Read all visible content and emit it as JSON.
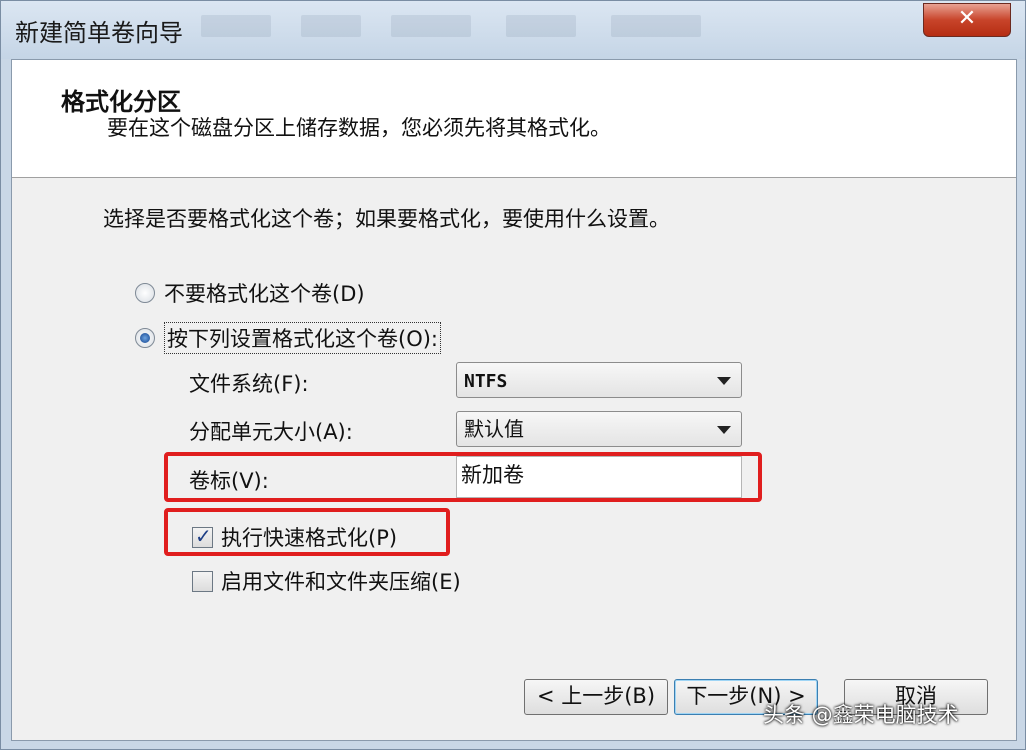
{
  "window": {
    "title": "新建简单卷向导",
    "close_glyph": "✕"
  },
  "header": {
    "title": "格式化分区",
    "description": "要在这个磁盘分区上储存数据，您必须先将其格式化。"
  },
  "prompt": "选择是否要格式化这个卷；如果要格式化，要使用什么设置。",
  "options": {
    "no_format": {
      "label": "不要格式化这个卷(D)",
      "selected": false
    },
    "format": {
      "label": "按下列设置格式化这个卷(O):",
      "selected": true
    }
  },
  "fields": {
    "file_system": {
      "label": "文件系统(F):",
      "value": "NTFS"
    },
    "allocation_unit": {
      "label": "分配单元大小(A):",
      "value": "默认值"
    },
    "volume_label": {
      "label": "卷标(V):",
      "value": "新加卷"
    }
  },
  "checkboxes": {
    "quick_format": {
      "label": "执行快速格式化(P)",
      "checked": true
    },
    "compression": {
      "label": "启用文件和文件夹压缩(E)",
      "checked": false
    }
  },
  "buttons": {
    "back": "< 上一步(B)",
    "next": "下一步(N) >",
    "cancel": "取消"
  },
  "watermark": "头条 @鑫荣电脑技术",
  "colors": {
    "highlight": "#e01e1e",
    "close_button": "#c8442a"
  }
}
